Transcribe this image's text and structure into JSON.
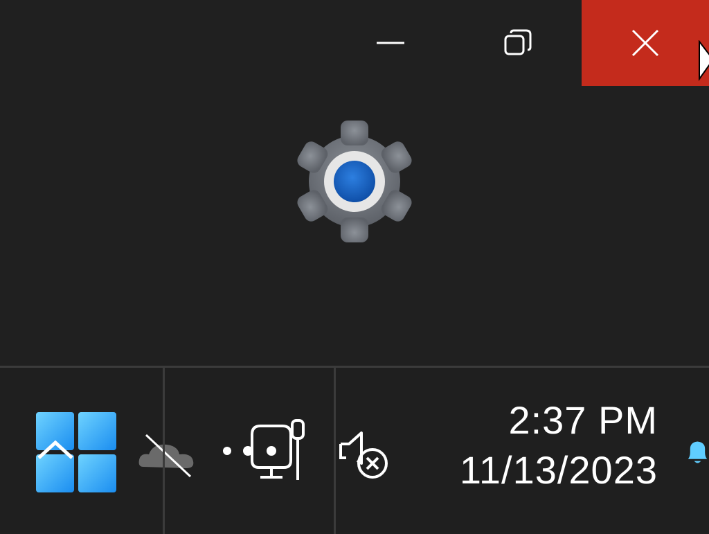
{
  "window": {
    "caption_buttons": {
      "minimize_icon": "minimize-icon",
      "maximize_icon": "restore-icon",
      "close_icon": "close-icon",
      "close_hover_color": "#c42b1c"
    },
    "app_icon": "settings-gear-icon",
    "accent_color": "#1a5fb4"
  },
  "taskbar": {
    "start_icon": "windows-start-icon",
    "tray_icons": [
      "onedrive-offline-icon",
      "network-wired-icon",
      "volume-muted-icon",
      "notification-bell-icon"
    ],
    "clock": {
      "time": "2:37 PM",
      "date": "11/13/2023"
    }
  }
}
